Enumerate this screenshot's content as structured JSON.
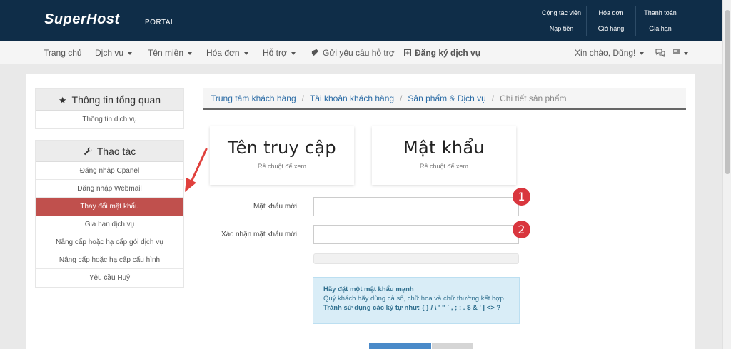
{
  "header": {
    "logo": "SuperHost",
    "logo_sub": "PORTAL",
    "top_links": [
      "Cộng tác viên",
      "Hóa đơn",
      "Thanh toán",
      "Nạp tiền",
      "Giỏ hàng",
      "Gia hạn"
    ]
  },
  "nav": {
    "items": [
      "Trang chủ",
      "Dịch vụ",
      "Tên miền",
      "Hóa đơn",
      "Hỗ trợ",
      "Gửi yêu cầu hỗ trợ",
      "Đăng ký dịch vụ"
    ],
    "greeting": "Xin chào, Dũng!"
  },
  "sidebar": {
    "overview_title": "Thông tin tổng quan",
    "overview_items": [
      "Thông tin dịch vụ"
    ],
    "actions_title": "Thao tác",
    "action_items": [
      "Đăng nhập Cpanel",
      "Đăng nhập Webmail",
      "Thay đổi mật khẩu",
      "Gia hạn dịch vụ",
      "Nâng cấp hoặc hạ cấp gói dịch vụ",
      "Nâng cấp hoặc hạ cấp cấu hình",
      "Yêu cầu Huỷ"
    ]
  },
  "breadcrumb": [
    "Trung tâm khách hàng",
    "Tài khoản khách hàng",
    "Sản phẩm & Dịch vụ",
    "Chi tiết sản phẩm"
  ],
  "credentials": {
    "username_title": "Tên truy cập",
    "password_title": "Mật khẩu",
    "hint": "Rê chuột để xem"
  },
  "form": {
    "new_password_label": "Mật khẩu mới",
    "confirm_label": "Xác nhận mật khẩu mới",
    "badges": [
      "1",
      "2"
    ]
  },
  "info": {
    "title": "Hãy đặt một mật khẩu mạnh",
    "line1": "Quý khách hãy dùng cả số, chữ hoa và chữ thường kết hợp",
    "line2": "Tránh sử dụng các ký tự như: { } / \\ ' \" ` , ; : . $ & ' | <> ?"
  },
  "colors": {
    "header_bg": "#0f2d48",
    "active_item": "#c0504d",
    "annotation": "#d9363e",
    "link": "#2a6ba5"
  }
}
